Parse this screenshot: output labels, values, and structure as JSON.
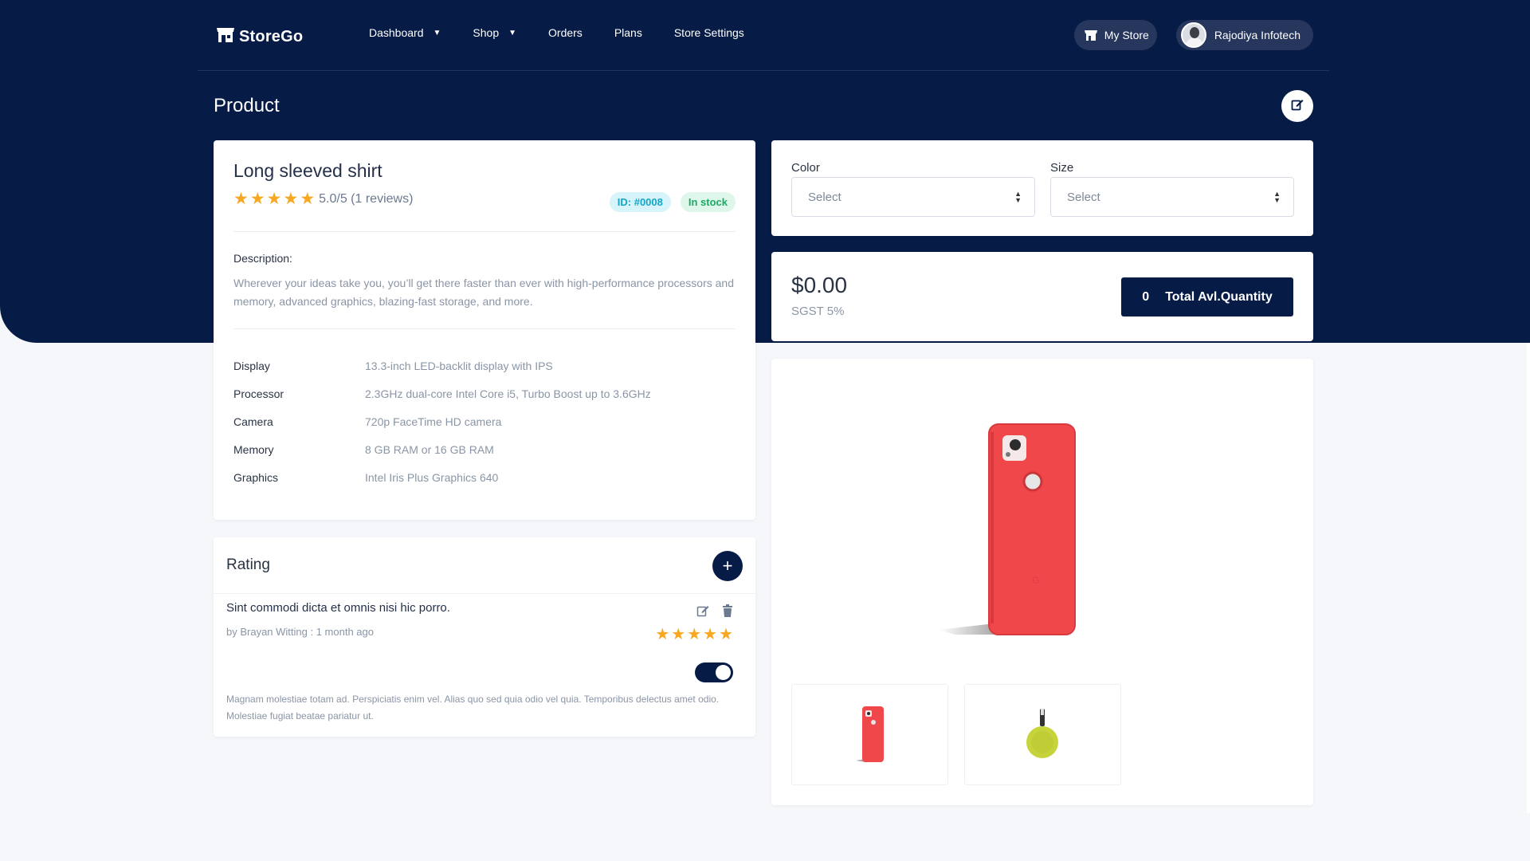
{
  "nav": {
    "brand": "StoreGo",
    "links": [
      {
        "label": "Dashboard",
        "dropdown": true
      },
      {
        "label": "Shop",
        "dropdown": true
      },
      {
        "label": "Orders",
        "dropdown": false
      },
      {
        "label": "Plans",
        "dropdown": false
      },
      {
        "label": "Store Settings",
        "dropdown": false
      }
    ],
    "my_store": "My Store",
    "user_name": "Rajodiya Infotech"
  },
  "page": {
    "title": "Product"
  },
  "product": {
    "name": "Long sleeved shirt",
    "rating": 5,
    "rating_text": "5.0/5 (1 reviews)",
    "id_badge": "ID: #0008",
    "stock_badge": "In stock",
    "description_label": "Description:",
    "description": "Wherever your ideas take you, you’ll get there faster than ever with high-performance processors and memory, advanced graphics, blazing-fast storage, and more.",
    "specs": [
      {
        "key": "Display",
        "value": "13.3-inch LED-backlit display with IPS"
      },
      {
        "key": "Processor",
        "value": "2.3GHz dual-core Intel Core i5, Turbo Boost up to 3.6GHz"
      },
      {
        "key": "Camera",
        "value": "720p FaceTime HD camera"
      },
      {
        "key": "Memory",
        "value": "8 GB RAM or 16 GB RAM"
      },
      {
        "key": "Graphics",
        "value": "Intel Iris Plus Graphics 640"
      }
    ]
  },
  "rating_section": {
    "title": "Rating",
    "review": {
      "title": "Sint commodi dicta et omnis nisi hic porro.",
      "meta": "by Brayan Witting : 1 month ago",
      "stars": 5,
      "enabled": true,
      "body": "Magnam molestiae totam ad. Perspiciatis enim vel. Alias quo sed quia odio vel quia. Temporibus delectus amet odio. Molestiae fugiat beatae pariatur ut."
    }
  },
  "variants": {
    "color_label": "Color",
    "color_value": "Select",
    "size_label": "Size",
    "size_value": "Select"
  },
  "pricing": {
    "price": "$0.00",
    "tax": "SGST 5%",
    "qty": "0",
    "qty_label": "Total Avl.Quantity"
  },
  "colors": {
    "navy": "#061b45",
    "star": "#f7a721",
    "phone_red": "#f0474a",
    "chromecast_lime": "#c7d33a"
  }
}
